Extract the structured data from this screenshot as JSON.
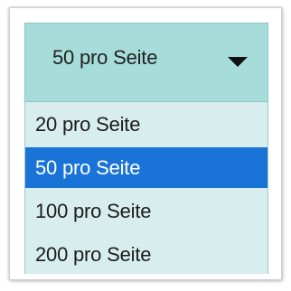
{
  "select": {
    "value": "50 pro Seite",
    "icon": "caret-down-icon"
  },
  "options": [
    {
      "label": "20 pro Seite",
      "selected": false
    },
    {
      "label": "50 pro Seite",
      "selected": true
    },
    {
      "label": "100 pro Seite",
      "selected": false
    },
    {
      "label": "200 pro Seite",
      "selected": false
    }
  ],
  "colors": {
    "button_bg": "#a6dcd9",
    "menu_bg": "#d8eeee",
    "selected_bg": "#1a73d6",
    "selected_text": "#ffffff"
  }
}
